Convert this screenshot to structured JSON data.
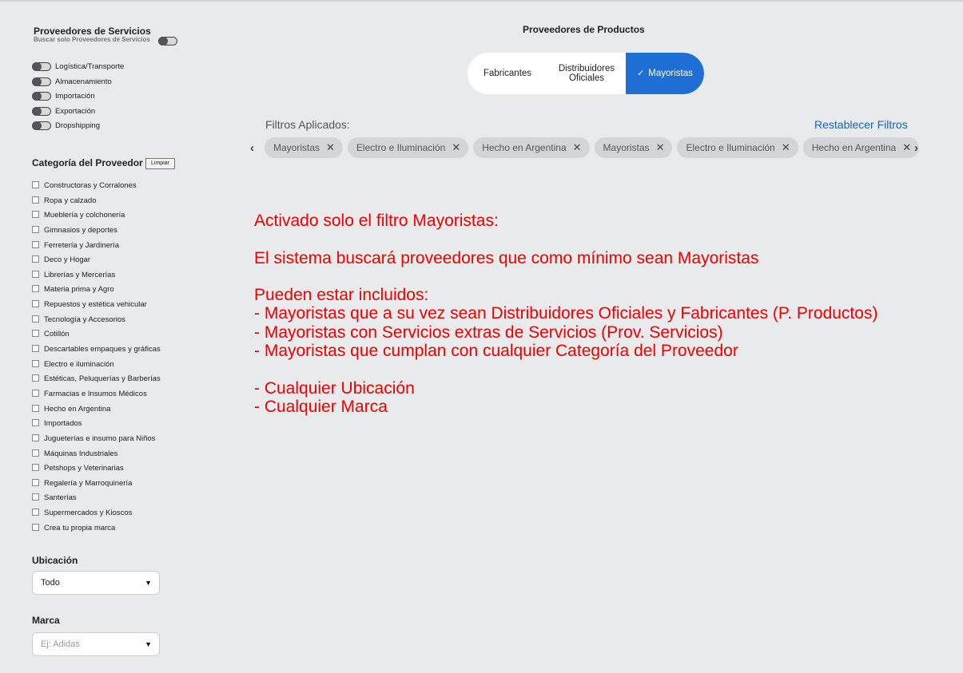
{
  "services": {
    "title": "Proveedores de Servicios",
    "subtitle": "Buscar solo Proveedores de Servicios",
    "items": [
      "Logística/Transporte",
      "Almacenamiento",
      "Importación",
      "Exportación",
      "Dropshipping"
    ]
  },
  "category": {
    "title": "Categoría del Proveedor",
    "clear_label": "Limpiar",
    "items": [
      "Constructoras y Corralones",
      "Ropa y calzado",
      "Mueblería y colchonería",
      "Gimnasios y deportes",
      "Ferretería y Jardinería",
      "Deco y Hogar",
      "Librerías y Mercerías",
      "Materia prima y Agro",
      "Repuestos y estética vehicular",
      "Tecnología y Accesorios",
      "Cotillón",
      "Descartables empaques y gráficas",
      "Electro e iluminación",
      "Estéticas, Peluquerías y Barberías",
      "Farmacias e Insumos Médicos",
      "Hecho en Argentina",
      "Importados",
      "Jugueterías e insumo para Niños",
      "Máquinas Industriales",
      "Petshops y Veterinarias",
      "Regalería y Marroquinería",
      "Santerías",
      "Supermercados y Kioscos",
      "Crea tu propia marca"
    ]
  },
  "location": {
    "title": "Ubicación",
    "value": "Todo"
  },
  "brand": {
    "title": "Marca",
    "placeholder": "Ej: Adidas"
  },
  "products": {
    "title": "Proveedores de Productos",
    "segments": [
      "Fabricantes",
      "Distribuidores Oficiales",
      "Mayoristas"
    ],
    "selected": "Mayoristas",
    "accent_color": "#1f6ed6"
  },
  "filters": {
    "applied_label": "Filtros Aplicados:",
    "reset_label": "Restablecer Filtros",
    "chips": [
      "Mayoristas",
      "Electro e Iluminación",
      "Hecho en Argentina",
      "Mayoristas",
      "Electro e Iluminación",
      "Hecho en Argentina"
    ]
  },
  "note": {
    "color": "#ee0000",
    "lines": [
      "Activado solo el filtro Mayoristas:",
      "",
      "El sistema buscará proveedores que como mínimo sean Mayoristas",
      "",
      "Pueden estar incluidos:",
      "- Mayoristas que a su vez sean Distribuidores Oficiales y Fabricantes (P. Productos)",
      "- Mayoristas con Servicios extras de Servicios (Prov. Servicios)",
      "- Mayoristas que cumplan con cualquier Categoría del Proveedor",
      "",
      "- Cualquier Ubicación",
      "- Cualquier Marca"
    ]
  }
}
